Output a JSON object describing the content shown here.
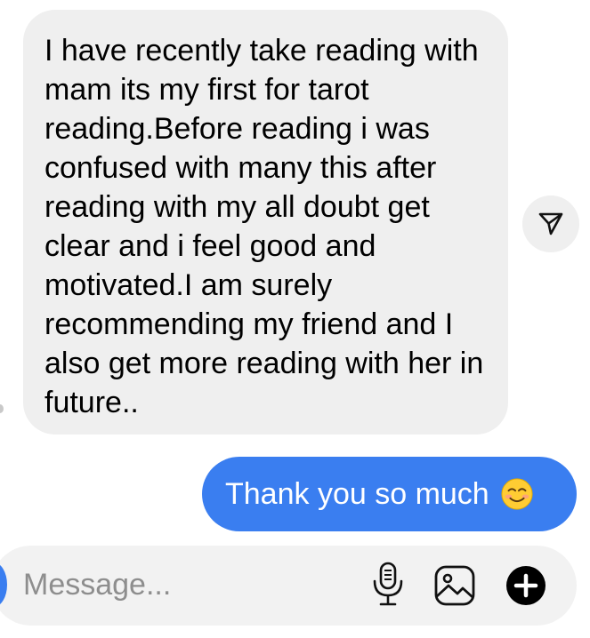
{
  "conversation": {
    "incoming_message": "I have recently take reading with mam its my first for tarot reading.Before reading i was confused with many this after reading with my all doubt get clear and i feel good and motivated.I am surely recommending my friend and I also get more reading with her in future..",
    "outgoing_message": "Thank you so much",
    "outgoing_emoji_icon": "smiling-face-emoji-icon"
  },
  "composer": {
    "placeholder": "Message..."
  },
  "colors": {
    "incoming_bubble": "#efefef",
    "outgoing_bubble": "#3a7ef0",
    "composer_background": "#f2f2f2",
    "placeholder_text": "#8e8e8e"
  },
  "icons": {
    "share": "paper-plane-icon",
    "mic": "microphone-icon",
    "gallery": "image-gallery-icon",
    "add": "plus-circle-icon"
  }
}
